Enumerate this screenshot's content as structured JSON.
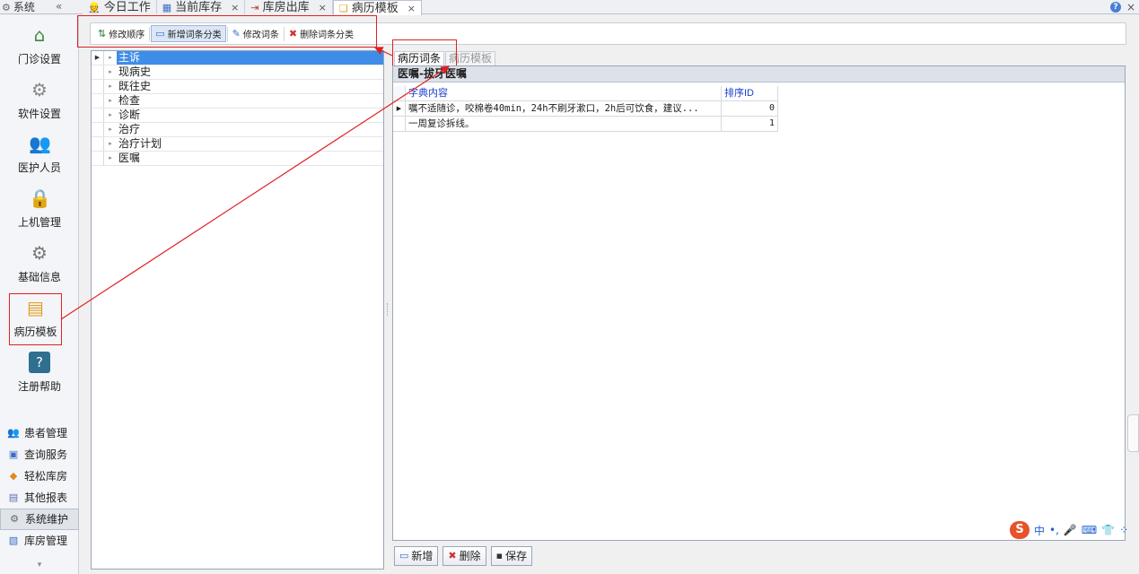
{
  "topbar": {
    "system_label": "系统",
    "collapse": "«",
    "tabs": [
      {
        "icon": "user-work-icon",
        "glyph": "👷",
        "label": "今日工作",
        "closable": false
      },
      {
        "icon": "grid-icon",
        "glyph": "▦",
        "label": "当前库存",
        "closable": true
      },
      {
        "icon": "outbound-icon",
        "glyph": "⇥",
        "label": "库房出库",
        "closable": true
      },
      {
        "icon": "template-icon",
        "glyph": "❏",
        "label": "病历模板",
        "closable": true,
        "active": true
      }
    ],
    "close_glyph": "×",
    "help_glyph": "?"
  },
  "leftnav": {
    "items": [
      {
        "label": "门诊设置",
        "glyph": "⌂"
      },
      {
        "label": "软件设置",
        "glyph": "⚙"
      },
      {
        "label": "医护人员",
        "glyph": "👥"
      },
      {
        "label": "上机管理",
        "glyph": "🔒"
      },
      {
        "label": "基础信息",
        "glyph": "⚙"
      },
      {
        "label": "病历模板",
        "glyph": "▤",
        "highlighted": true
      },
      {
        "label": "注册帮助",
        "glyph": "?"
      }
    ],
    "bottom": [
      {
        "label": "患者管理",
        "glyph": "👥"
      },
      {
        "label": "查询服务",
        "glyph": "▣"
      },
      {
        "label": "轻松库房",
        "glyph": "◆"
      },
      {
        "label": "其他报表",
        "glyph": "▤"
      },
      {
        "label": "系统维护",
        "glyph": "⚙",
        "selected": true
      },
      {
        "label": "库房管理",
        "glyph": "▧"
      }
    ],
    "more_glyph": "▾"
  },
  "toolbar": {
    "buttons": [
      {
        "label": "修改顺序",
        "glyph": "⇅",
        "pressed": false
      },
      {
        "label": "新增词条分类",
        "glyph": "▭",
        "pressed": true
      },
      {
        "label": "修改词条",
        "glyph": "✎",
        "pressed": false
      },
      {
        "label": "删除词条分类",
        "glyph": "✖",
        "pressed": false
      }
    ]
  },
  "tree": {
    "rows": [
      {
        "label": "主诉",
        "selected": true
      },
      {
        "label": "现病史"
      },
      {
        "label": "既往史"
      },
      {
        "label": "检查"
      },
      {
        "label": "诊断"
      },
      {
        "label": "治疗"
      },
      {
        "label": "治疗计划"
      },
      {
        "label": "医嘱"
      }
    ]
  },
  "right": {
    "tabs": [
      "病历词条",
      "病历模板"
    ],
    "panel_title": "医嘱-拔牙医嘱",
    "columns": [
      "字典内容",
      "排序ID"
    ],
    "rows": [
      {
        "content": "嘱不适随诊，咬棉卷40min，24h不刷牙漱口，2h后可饮食，建议...",
        "sort": "0",
        "current": true
      },
      {
        "content": "一周复诊拆线。",
        "sort": "1"
      }
    ]
  },
  "bottom_buttons": [
    {
      "label": "新增",
      "glyph": "▭"
    },
    {
      "label": "删除",
      "glyph": "✖"
    },
    {
      "label": "保存",
      "glyph": "▪"
    }
  ],
  "ime": {
    "logo": "S",
    "items": [
      "中",
      "•,",
      "🎤",
      "⌨",
      "👕",
      "⁘"
    ]
  },
  "colors": {
    "accent_selection": "#3f8de8",
    "annotation_red": "#e02020",
    "grid_header_blue": "#1a3fd0"
  }
}
